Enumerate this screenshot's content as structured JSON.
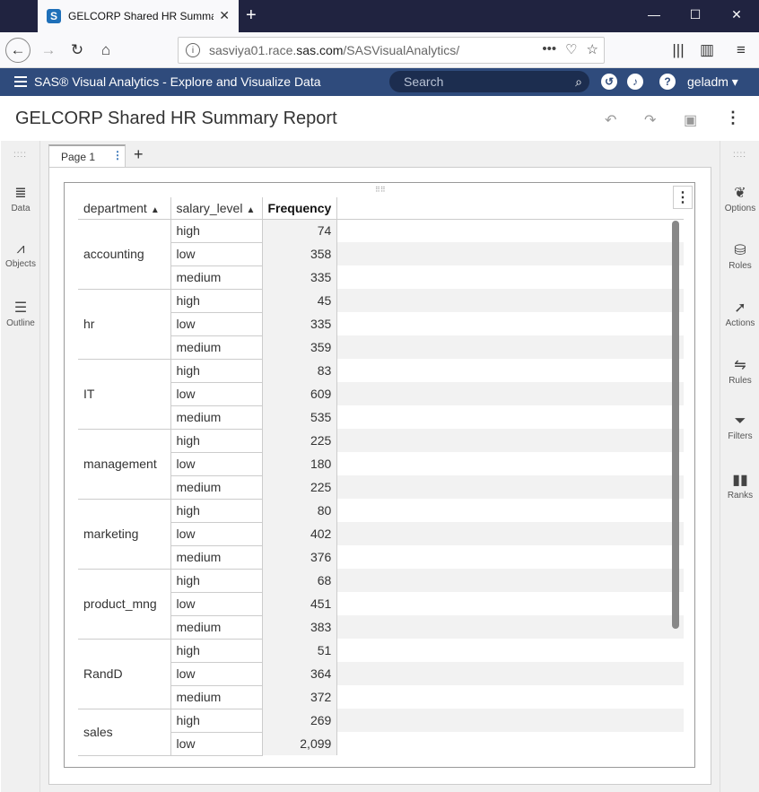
{
  "browser": {
    "tab_title": "GELCORP Shared HR Summary",
    "tab_icon_letter": "S",
    "url_prefix": "sasviya01.race.",
    "url_domain": "sas.com",
    "url_path": "/SASVisualAnalytics/"
  },
  "app": {
    "title": "SAS® Visual Analytics - Explore and Visualize Data",
    "search_placeholder": "Search",
    "user": "geladm"
  },
  "report": {
    "title": "GELCORP Shared HR Summary Report",
    "page_tab": "Page 1"
  },
  "left_pane": [
    {
      "label": "Data",
      "icon": "database-icon"
    },
    {
      "label": "Objects",
      "icon": "chart-icon"
    },
    {
      "label": "Outline",
      "icon": "list-icon"
    }
  ],
  "right_pane": [
    {
      "label": "Options",
      "icon": "paint-icon"
    },
    {
      "label": "Roles",
      "icon": "roles-icon"
    },
    {
      "label": "Actions",
      "icon": "cursor-icon"
    },
    {
      "label": "Rules",
      "icon": "rules-icon"
    },
    {
      "label": "Filters",
      "icon": "filter-icon"
    },
    {
      "label": "Ranks",
      "icon": "ranks-icon"
    }
  ],
  "crosstab": {
    "headers": {
      "department": "department",
      "salary_level": "salary_level",
      "frequency": "Frequency"
    },
    "rows": [
      {
        "dept": "accounting",
        "levels": [
          [
            "high",
            "74"
          ],
          [
            "low",
            "358"
          ],
          [
            "medium",
            "335"
          ]
        ]
      },
      {
        "dept": "hr",
        "levels": [
          [
            "high",
            "45"
          ],
          [
            "low",
            "335"
          ],
          [
            "medium",
            "359"
          ]
        ]
      },
      {
        "dept": "IT",
        "levels": [
          [
            "high",
            "83"
          ],
          [
            "low",
            "609"
          ],
          [
            "medium",
            "535"
          ]
        ]
      },
      {
        "dept": "management",
        "levels": [
          [
            "high",
            "225"
          ],
          [
            "low",
            "180"
          ],
          [
            "medium",
            "225"
          ]
        ]
      },
      {
        "dept": "marketing",
        "levels": [
          [
            "high",
            "80"
          ],
          [
            "low",
            "402"
          ],
          [
            "medium",
            "376"
          ]
        ]
      },
      {
        "dept": "product_mng",
        "levels": [
          [
            "high",
            "68"
          ],
          [
            "low",
            "451"
          ],
          [
            "medium",
            "383"
          ]
        ]
      },
      {
        "dept": "RandD",
        "levels": [
          [
            "high",
            "51"
          ],
          [
            "low",
            "364"
          ],
          [
            "medium",
            "372"
          ]
        ]
      },
      {
        "dept": "sales",
        "levels": [
          [
            "high",
            "269"
          ],
          [
            "low",
            "2,099"
          ]
        ]
      }
    ]
  }
}
